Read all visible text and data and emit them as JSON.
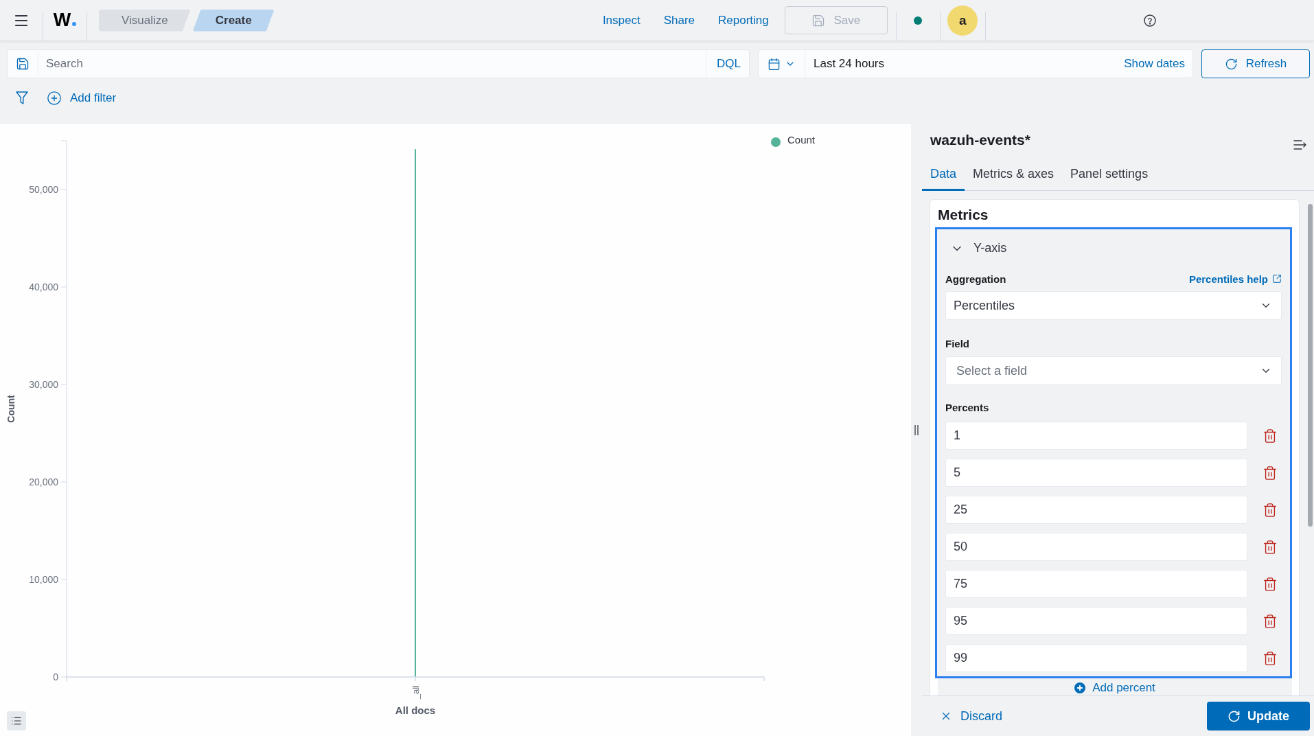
{
  "header": {
    "logo": "W",
    "breadcrumbs": [
      {
        "label": "Visualize",
        "selected": false
      },
      {
        "label": "Create",
        "selected": true
      }
    ],
    "links": [
      "Inspect",
      "Share",
      "Reporting"
    ],
    "save": {
      "label": "Save",
      "disabled": true
    },
    "avatar": "a"
  },
  "query_bar": {
    "search": {
      "placeholder": "Search"
    },
    "language": "DQL",
    "time_range": "Last 24 hours",
    "show_dates": "Show dates",
    "refresh": "Refresh"
  },
  "filter_bar": {
    "add_filter": "Add filter"
  },
  "chart": {
    "chart_data": {
      "type": "bar",
      "xlabel": "All docs",
      "ylabel": "Count",
      "categories": [
        "_all"
      ],
      "series": [
        {
          "name": "Count",
          "color": "#54b399",
          "values": [
            54140
          ]
        }
      ],
      "ylim": [
        0,
        55000
      ],
      "yticks": [
        {
          "value": 0,
          "label": "0"
        },
        {
          "value": 10000,
          "label": "10,000"
        },
        {
          "value": 20000,
          "label": "20,000"
        },
        {
          "value": 30000,
          "label": "30,000"
        },
        {
          "value": 40000,
          "label": "40,000"
        },
        {
          "value": 50000,
          "label": "50,000"
        }
      ]
    }
  },
  "editor": {
    "title": "wazuh-events*",
    "tabs": [
      {
        "label": "Data",
        "selected": true
      },
      {
        "label": "Metrics & axes",
        "selected": false
      },
      {
        "label": "Panel settings",
        "selected": false
      }
    ],
    "section_title": "Metrics",
    "metric": {
      "title": "Y-axis",
      "expanded": true,
      "focused": true,
      "aggregation": {
        "label": "Aggregation",
        "help": "Percentiles help",
        "value": "Percentiles"
      },
      "field": {
        "label": "Field",
        "placeholder": "Select a field"
      },
      "percents": {
        "label": "Percents",
        "values": [
          "1",
          "5",
          "25",
          "50",
          "75",
          "95",
          "99"
        ],
        "add": "Add percent"
      }
    }
  },
  "footer": {
    "discard": "Discard",
    "update": "Update"
  }
}
